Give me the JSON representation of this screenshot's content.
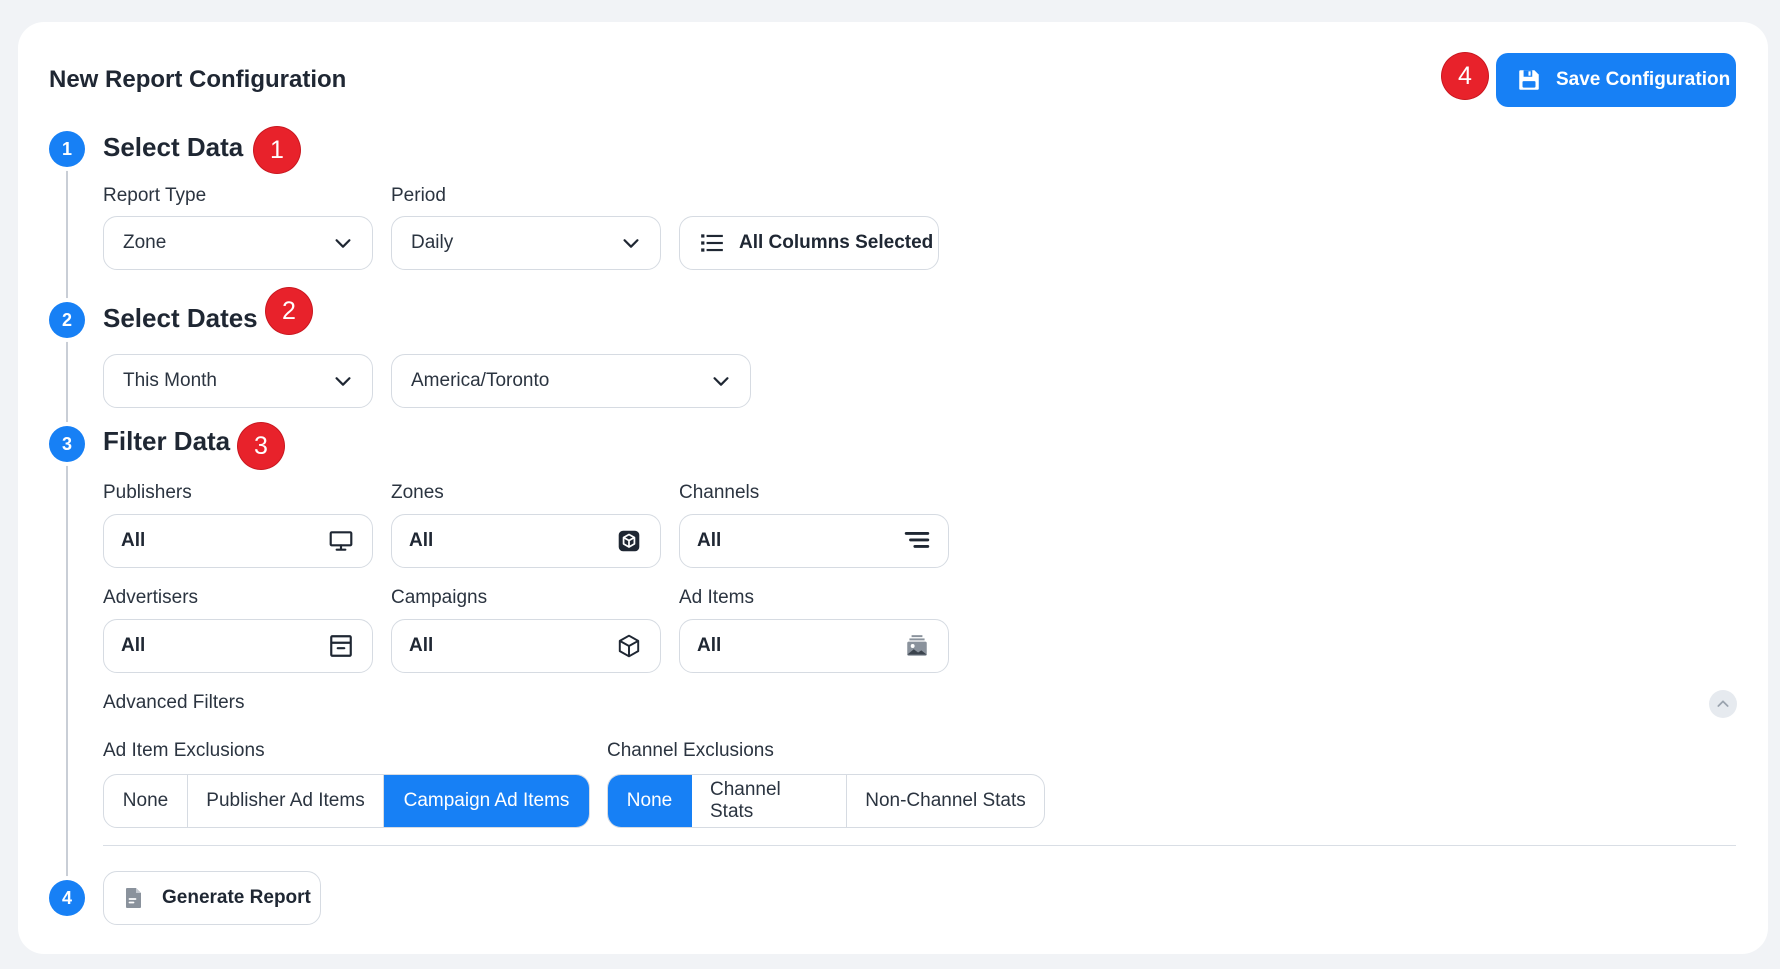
{
  "header": {
    "title": "New Report Configuration",
    "save_label": "Save Configuration"
  },
  "markers": [
    "1",
    "2",
    "3",
    "4"
  ],
  "steps": [
    "1",
    "2",
    "3",
    "4"
  ],
  "select_data": {
    "title": "Select Data",
    "report_type_label": "Report Type",
    "report_type_value": "Zone",
    "period_label": "Period",
    "period_value": "Daily",
    "columns_label": "All Columns Selected"
  },
  "select_dates": {
    "title": "Select Dates",
    "range_value": "This Month",
    "timezone_value": "America/Toronto"
  },
  "filter_data": {
    "title": "Filter Data",
    "filters": [
      {
        "label": "Publishers",
        "value": "All",
        "icon": "monitor-icon"
      },
      {
        "label": "Zones",
        "value": "All",
        "icon": "zone-box-icon"
      },
      {
        "label": "Channels",
        "value": "All",
        "icon": "channels-icon"
      },
      {
        "label": "Advertisers",
        "value": "All",
        "icon": "advertiser-icon"
      },
      {
        "label": "Campaigns",
        "value": "All",
        "icon": "cube-icon"
      },
      {
        "label": "Ad Items",
        "value": "All",
        "icon": "ad-items-icon"
      }
    ],
    "advanced_label": "Advanced Filters",
    "ad_item_exclusions_label": "Ad Item Exclusions",
    "ad_item_exclusions": [
      "None",
      "Publisher Ad Items",
      "Campaign Ad Items"
    ],
    "ad_item_exclusions_selected": "Campaign Ad Items",
    "channel_exclusions_label": "Channel Exclusions",
    "channel_exclusions": [
      "None",
      "Channel Stats",
      "Non-Channel Stats"
    ],
    "channel_exclusions_selected": "None"
  },
  "generate": {
    "label": "Generate Report"
  },
  "colors": {
    "accent": "#1780f5",
    "marker": "#e8222b",
    "background": "#f1f3f6"
  }
}
